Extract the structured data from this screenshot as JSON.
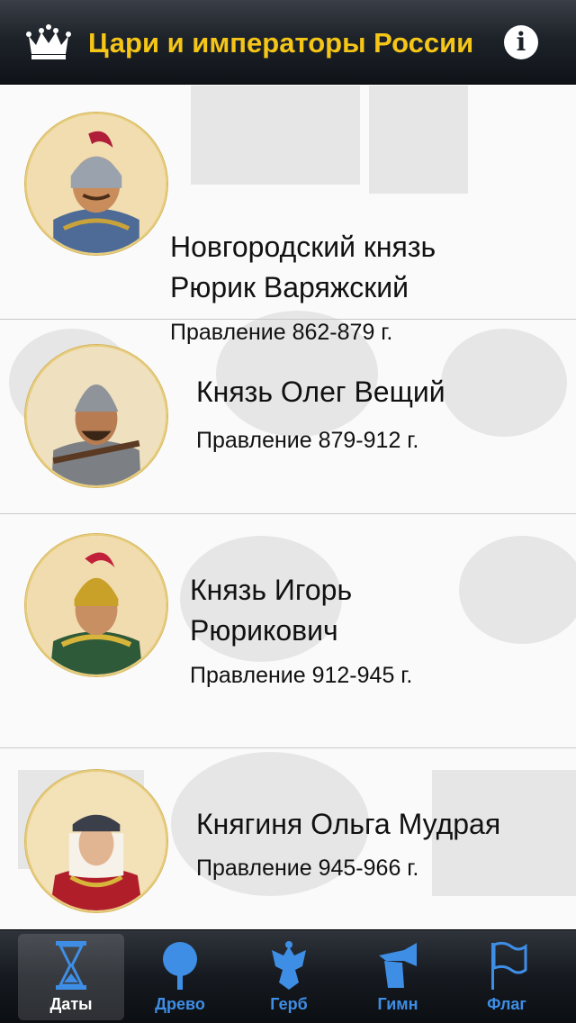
{
  "header": {
    "title": "Цари и императоры России",
    "info_label": "i"
  },
  "rulers": [
    {
      "name_line1": "Новгородский князь",
      "name_line2": "Рюрик Варяжский",
      "reign": "Правление 862-879 г."
    },
    {
      "name_line1": "Князь Олег Вещий",
      "name_line2": "",
      "reign": "Правление 879-912 г."
    },
    {
      "name_line1": "Князь Игорь",
      "name_line2": "Рюрикович",
      "reign": "Правление 912-945 г."
    },
    {
      "name_line1": "Княгиня Ольга Мудрая",
      "name_line2": "",
      "reign": "Правление 945-966 г."
    }
  ],
  "tabs": [
    {
      "label": "Даты",
      "icon": "hourglass-icon",
      "active": true
    },
    {
      "label": "Древо",
      "icon": "tree-icon",
      "active": false
    },
    {
      "label": "Герб",
      "icon": "double-eagle-icon",
      "active": false
    },
    {
      "label": "Гимн",
      "icon": "trumpet-icon",
      "active": false
    },
    {
      "label": "Флаг",
      "icon": "flag-icon",
      "active": false
    }
  ],
  "colors": {
    "title": "#f5c518",
    "tab_inactive": "#3f8ee6",
    "tab_active": "#ffffff"
  }
}
